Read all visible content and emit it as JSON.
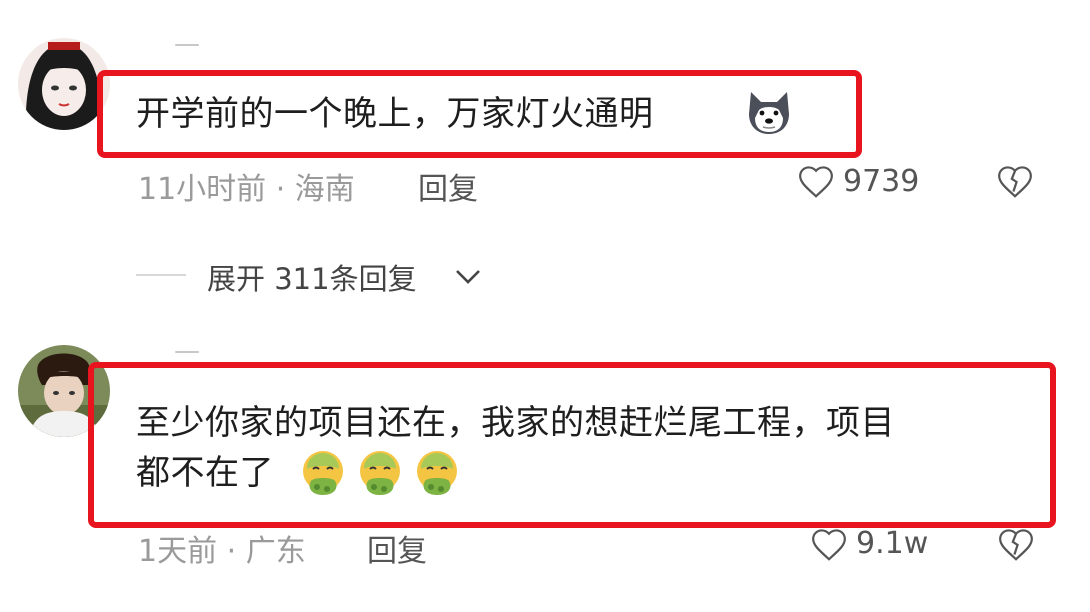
{
  "comments": [
    {
      "text": "开学前的一个晚上，万家灯火通明",
      "emoji_icon": "husky-dog-face",
      "meta": "11小时前 · 海南",
      "reply_label": "回复",
      "likes": "9739"
    },
    {
      "text_line1": "至少你家的项目还在，我家的想赶烂尾工程，项目",
      "text_line2": "都不在了",
      "emoji_icon": "nauseated-face",
      "emoji_count": 3,
      "meta": "1天前 · 广东",
      "reply_label": "回复",
      "likes": "9.1w"
    }
  ],
  "expand": {
    "label": "展开 311条回复"
  },
  "colors": {
    "highlight": "#e8141e",
    "meta": "#9a9a9a",
    "text": "#1e1e1e"
  }
}
